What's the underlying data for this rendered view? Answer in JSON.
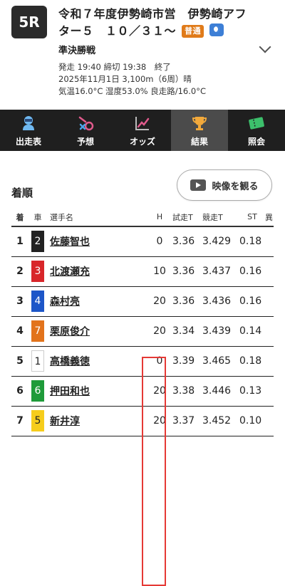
{
  "header": {
    "race_number": "5R",
    "title": "令和７年度伊勢崎市営　伊勢崎アフター５　１０／３１～",
    "badge": "普通",
    "subtitle": "準決勝戦",
    "info_lines": [
      "発走 19:40 締切 19:38　終了",
      "2025年11月1日 3,100m（6周）晴",
      "気温16.0°C 湿度53.0% 良走路/16.0°C"
    ]
  },
  "nav": {
    "items": [
      {
        "label": "出走表",
        "icon": "racer-icon"
      },
      {
        "label": "予想",
        "icon": "prediction-icon"
      },
      {
        "label": "オッズ",
        "icon": "odds-chart-icon"
      },
      {
        "label": "結果",
        "icon": "trophy-icon"
      },
      {
        "label": "照会",
        "icon": "ticket-icon"
      }
    ],
    "active": "結果"
  },
  "results": {
    "title": "着順",
    "video_button": "映像を観る",
    "columns": [
      "着",
      "車",
      "選手名",
      "H",
      "試走T",
      "競走T",
      "ST",
      "異"
    ],
    "rows": [
      {
        "rank": "1",
        "car": "2",
        "name": "佐藤智也",
        "h": "0",
        "trial": "3.36",
        "race": "3.429",
        "st": "0.18",
        "note": ""
      },
      {
        "rank": "2",
        "car": "3",
        "name": "北渡瀬充",
        "h": "10",
        "trial": "3.36",
        "race": "3.437",
        "st": "0.16",
        "note": ""
      },
      {
        "rank": "3",
        "car": "4",
        "name": "森村亮",
        "h": "20",
        "trial": "3.36",
        "race": "3.436",
        "st": "0.16",
        "note": ""
      },
      {
        "rank": "4",
        "car": "7",
        "name": "栗原俊介",
        "h": "20",
        "trial": "3.34",
        "race": "3.439",
        "st": "0.14",
        "note": ""
      },
      {
        "rank": "5",
        "car": "1",
        "name": "高橋義徳",
        "h": "0",
        "trial": "3.39",
        "race": "3.465",
        "st": "0.18",
        "note": ""
      },
      {
        "rank": "6",
        "car": "6",
        "name": "押田和也",
        "h": "20",
        "trial": "3.38",
        "race": "3.446",
        "st": "0.13",
        "note": ""
      },
      {
        "rank": "7",
        "car": "5",
        "name": "新井淳",
        "h": "20",
        "trial": "3.37",
        "race": "3.452",
        "st": "0.10",
        "note": ""
      }
    ]
  },
  "colors": {
    "car_1": {
      "bg": "#ffffff",
      "fg": "#222222"
    },
    "car_2": {
      "bg": "#222222",
      "fg": "#ffffff"
    },
    "car_3": {
      "bg": "#d8262a",
      "fg": "#ffffff"
    },
    "car_4": {
      "bg": "#1d56c8",
      "fg": "#ffffff"
    },
    "car_5": {
      "bg": "#f6cd1c",
      "fg": "#222222"
    },
    "car_6": {
      "bg": "#1f9b3a",
      "fg": "#ffffff"
    },
    "car_7": {
      "bg": "#e2731c",
      "fg": "#ffffff"
    },
    "h_highlight": "#e53935",
    "futsu_badge": "#e07b1a"
  }
}
